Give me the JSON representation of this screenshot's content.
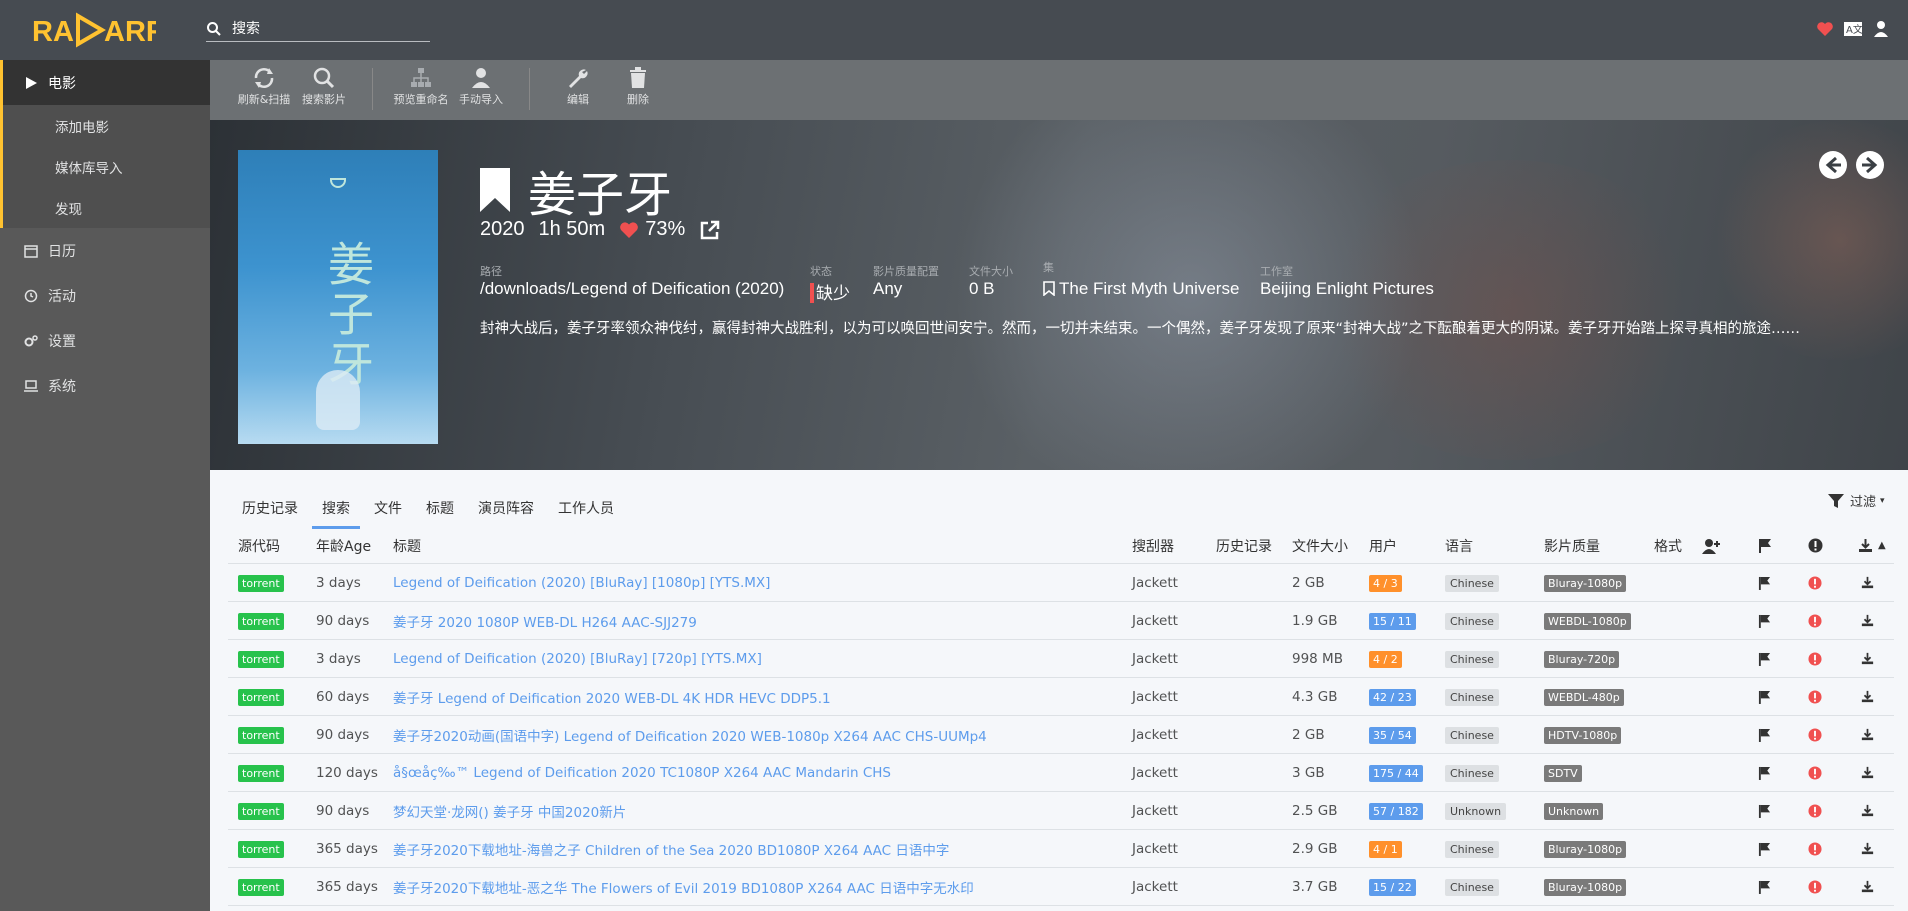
{
  "app": {
    "logo_text": "RADARR"
  },
  "search": {
    "placeholder": "搜索"
  },
  "sidebar": {
    "items": [
      {
        "label": "电影"
      },
      {
        "label": "添加电影"
      },
      {
        "label": "媒体库导入"
      },
      {
        "label": "发现"
      },
      {
        "label": "日历"
      },
      {
        "label": "活动"
      },
      {
        "label": "设置"
      },
      {
        "label": "系统"
      }
    ]
  },
  "toolbar": {
    "refresh": "刷新&扫描",
    "search_movie": "搜索影片",
    "preview_rename": "预览重命名",
    "manual_import": "手动导入",
    "edit": "编辑",
    "delete": "删除"
  },
  "movie": {
    "title": "姜子牙",
    "year": "2020",
    "runtime": "1h 50m",
    "rating": "73%",
    "path_label": "路径",
    "path": "/downloads/Legend of Deification (2020)",
    "status_label": "状态",
    "status": "缺少",
    "profile_label": "影片质量配置",
    "profile": "Any",
    "size_label": "文件大小",
    "size": "0 B",
    "collection_label": "集",
    "collection": "The First Myth Universe",
    "studio_label": "工作室",
    "studio": "Beijing Enlight Pictures",
    "overview": "封神大战后，姜子牙率领众神伐纣，赢得封神大战胜利，以为可以唤回世间安宁。然而，一切并未结束。一个偶然，姜子牙发现了原来“封神大战”之下酝酿着更大的阴谋。姜子牙开始踏上探寻真相的旅途……",
    "poster_text": "姜子牙"
  },
  "tabs": [
    "历史记录",
    "搜索",
    "文件",
    "标题",
    "演员阵容",
    "工作人员"
  ],
  "filter_label": "过滤",
  "table": {
    "headers": {
      "source": "源代码",
      "age": "年龄Age",
      "title": "标题",
      "indexer": "搜刮器",
      "history": "历史记录",
      "size": "文件大小",
      "peers": "用户",
      "language": "语言",
      "quality": "影片质量",
      "format": "格式"
    },
    "rows": [
      {
        "source": "torrent",
        "age": "3 days",
        "title": "Legend of Deification (2020) [BluRay] [1080p] [YTS.MX]",
        "indexer": "Jackett",
        "size": "2 GB",
        "peers": "4 / 3",
        "peer_color": "#ff902b",
        "language": "Chinese",
        "quality": "Bluray-1080p"
      },
      {
        "source": "torrent",
        "age": "90 days",
        "title": "姜子牙 2020 1080P WEB-DL H264 AAC-SJJ279",
        "indexer": "Jackett",
        "size": "1.9 GB",
        "peers": "15 / 11",
        "peer_color": "#5d9cec",
        "language": "Chinese",
        "quality": "WEBDL-1080p"
      },
      {
        "source": "torrent",
        "age": "3 days",
        "title": "Legend of Deification (2020) [BluRay] [720p] [YTS.MX]",
        "indexer": "Jackett",
        "size": "998 MB",
        "peers": "4 / 2",
        "peer_color": "#ff902b",
        "language": "Chinese",
        "quality": "Bluray-720p"
      },
      {
        "source": "torrent",
        "age": "60 days",
        "title": "姜子牙 Legend of Deification 2020 WEB-DL 4K HDR HEVC DDP5.1",
        "indexer": "Jackett",
        "size": "4.3 GB",
        "peers": "42 / 23",
        "peer_color": "#5d9cec",
        "language": "Chinese",
        "quality": "WEBDL-480p"
      },
      {
        "source": "torrent",
        "age": "90 days",
        "title": "姜子牙2020动画(国语中字) Legend of Deification 2020 WEB-1080p X264 AAC CHS-UUMp4",
        "indexer": "Jackett",
        "size": "2 GB",
        "peers": "35 / 54",
        "peer_color": "#5d9cec",
        "language": "Chinese",
        "quality": "HDTV-1080p"
      },
      {
        "source": "torrent",
        "age": "120 days",
        "title": "å§œå­ç‰™ Legend of Deification 2020 TC1080P X264 AAC Mandarin CHS",
        "indexer": "Jackett",
        "size": "3 GB",
        "peers": "175 / 44",
        "peer_color": "#5d9cec",
        "language": "Chinese",
        "quality": "SDTV"
      },
      {
        "source": "torrent",
        "age": "90 days",
        "title": "梦幻天堂·龙网() 姜子牙 中国2020新片",
        "indexer": "Jackett",
        "size": "2.5 GB",
        "peers": "57 / 182",
        "peer_color": "#5d9cec",
        "language": "Unknown",
        "quality": "Unknown"
      },
      {
        "source": "torrent",
        "age": "365 days",
        "title": "姜子牙2020下载地址-海兽之子 Children of the Sea 2020 BD1080P X264 AAC 日语中字",
        "indexer": "Jackett",
        "size": "2.9 GB",
        "peers": "4 / 1",
        "peer_color": "#ff902b",
        "language": "Chinese",
        "quality": "Bluray-1080p"
      },
      {
        "source": "torrent",
        "age": "365 days",
        "title": "姜子牙2020下载地址-恶之华 The Flowers of Evil 2019 BD1080P X264 AAC 日语中字无水印",
        "indexer": "Jackett",
        "size": "3.7 GB",
        "peers": "15 / 22",
        "peer_color": "#5d9cec",
        "language": "Chinese",
        "quality": "Bluray-1080p"
      }
    ]
  },
  "colors": {
    "accent": "#ffc230",
    "link": "#5d9cec",
    "torrent": "#27c24c",
    "danger": "#f05050"
  }
}
